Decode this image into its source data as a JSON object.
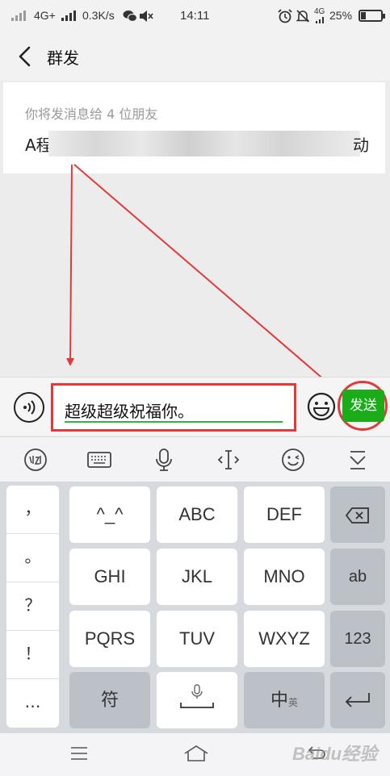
{
  "status_bar": {
    "network": "4G+",
    "speed": "0.3K/s",
    "time": "14:11",
    "secondary_network": "4G",
    "battery_percent": "25%",
    "battery_level": 0.25
  },
  "header": {
    "title": "群发"
  },
  "recipients": {
    "hint": "你将发消息给 4 位朋友",
    "first_name_char": "A程",
    "last_name_char": "动"
  },
  "composer": {
    "message": "超级超级祝福你。",
    "send_label": "发送"
  },
  "colors": {
    "accent_green": "#1aad19",
    "annotation_red": "#e23a3a"
  },
  "ime_toolbar": {
    "icons": [
      "handwriting-logo-icon",
      "keyboard-icon",
      "microphone-icon",
      "cursor-move-icon",
      "emoticon-icon",
      "collapse-keyboard-icon"
    ]
  },
  "keyboard": {
    "punctuation": [
      "，",
      "。",
      "？",
      "！",
      "…"
    ],
    "rows": [
      [
        "^_^",
        "ABC",
        "DEF"
      ],
      [
        "GHI",
        "JKL",
        "MNO"
      ],
      [
        "PQRS",
        "TUV",
        "WXYZ"
      ]
    ],
    "ab_label": "ab",
    "num_label": "123",
    "symbol_label": "符",
    "lang_label": "中",
    "lang_sub_label": "英"
  },
  "watermark": "Baidu经验"
}
